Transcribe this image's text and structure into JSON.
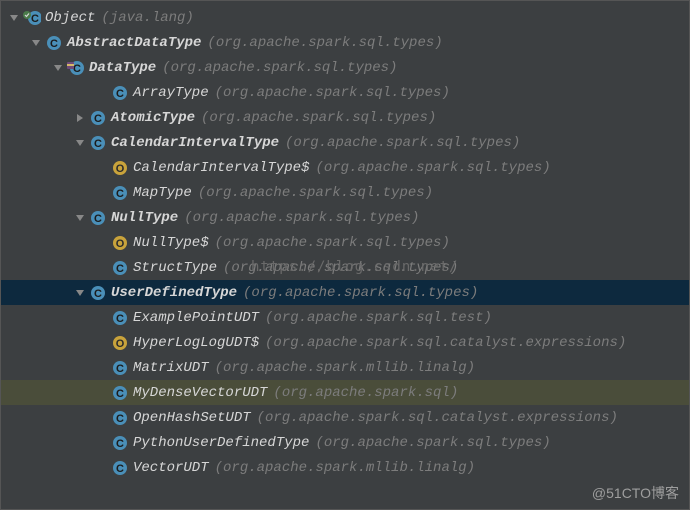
{
  "watermark_url": "https://blog.csdn.net/",
  "watermark_src": "@51CTO博客",
  "nodes": [
    {
      "indent": 0,
      "arrow": "down",
      "icon": "class-overlay",
      "name": "Object",
      "pkg": "(java.lang)"
    },
    {
      "indent": 22,
      "arrow": "down",
      "icon": "class",
      "name": "AbstractDataType",
      "pkg": "(org.apache.spark.sql.types)",
      "bold": true
    },
    {
      "indent": 44,
      "arrow": "down",
      "icon": "class-final",
      "name": "DataType",
      "pkg": "(org.apache.spark.sql.types)",
      "bold": true
    },
    {
      "indent": 88,
      "arrow": "blank",
      "icon": "class",
      "name": "ArrayType",
      "pkg": "(org.apache.spark.sql.types)"
    },
    {
      "indent": 66,
      "arrow": "right",
      "icon": "class",
      "name": "AtomicType",
      "pkg": "(org.apache.spark.sql.types)",
      "bold": true
    },
    {
      "indent": 66,
      "arrow": "down",
      "icon": "class",
      "name": "CalendarIntervalType",
      "pkg": "(org.apache.spark.sql.types)",
      "bold": true
    },
    {
      "indent": 88,
      "arrow": "blank",
      "icon": "object",
      "name": "CalendarIntervalType$",
      "pkg": "(org.apache.spark.sql.types)"
    },
    {
      "indent": 88,
      "arrow": "blank",
      "icon": "class",
      "name": "MapType",
      "pkg": "(org.apache.spark.sql.types)"
    },
    {
      "indent": 66,
      "arrow": "down",
      "icon": "class",
      "name": "NullType",
      "pkg": "(org.apache.spark.sql.types)",
      "bold": true
    },
    {
      "indent": 88,
      "arrow": "blank",
      "icon": "object",
      "name": "NullType$",
      "pkg": "(org.apache.spark.sql.types)"
    },
    {
      "indent": 88,
      "arrow": "blank",
      "icon": "class",
      "name": "StructType",
      "pkg": "(org.apache.spark.sql.types)"
    },
    {
      "indent": 66,
      "arrow": "down",
      "icon": "class",
      "name": "UserDefinedType",
      "pkg": "(org.apache.spark.sql.types)",
      "bold": true,
      "selected": true
    },
    {
      "indent": 88,
      "arrow": "blank",
      "icon": "class",
      "name": "ExamplePointUDT",
      "pkg": "(org.apache.spark.sql.test)"
    },
    {
      "indent": 88,
      "arrow": "blank",
      "icon": "object",
      "name": "HyperLogLogUDT$",
      "pkg": "(org.apache.spark.sql.catalyst.expressions)"
    },
    {
      "indent": 88,
      "arrow": "blank",
      "icon": "class",
      "name": "MatrixUDT",
      "pkg": "(org.apache.spark.mllib.linalg)"
    },
    {
      "indent": 88,
      "arrow": "blank",
      "icon": "class",
      "name": "MyDenseVectorUDT",
      "pkg": "(org.apache.spark.sql)",
      "highlight": true
    },
    {
      "indent": 88,
      "arrow": "blank",
      "icon": "class",
      "name": "OpenHashSetUDT",
      "pkg": "(org.apache.spark.sql.catalyst.expressions)"
    },
    {
      "indent": 88,
      "arrow": "blank",
      "icon": "class",
      "name": "PythonUserDefinedType",
      "pkg": "(org.apache.spark.sql.types)"
    },
    {
      "indent": 88,
      "arrow": "blank",
      "icon": "class",
      "name": "VectorUDT",
      "pkg": "(org.apache.spark.mllib.linalg)"
    }
  ]
}
